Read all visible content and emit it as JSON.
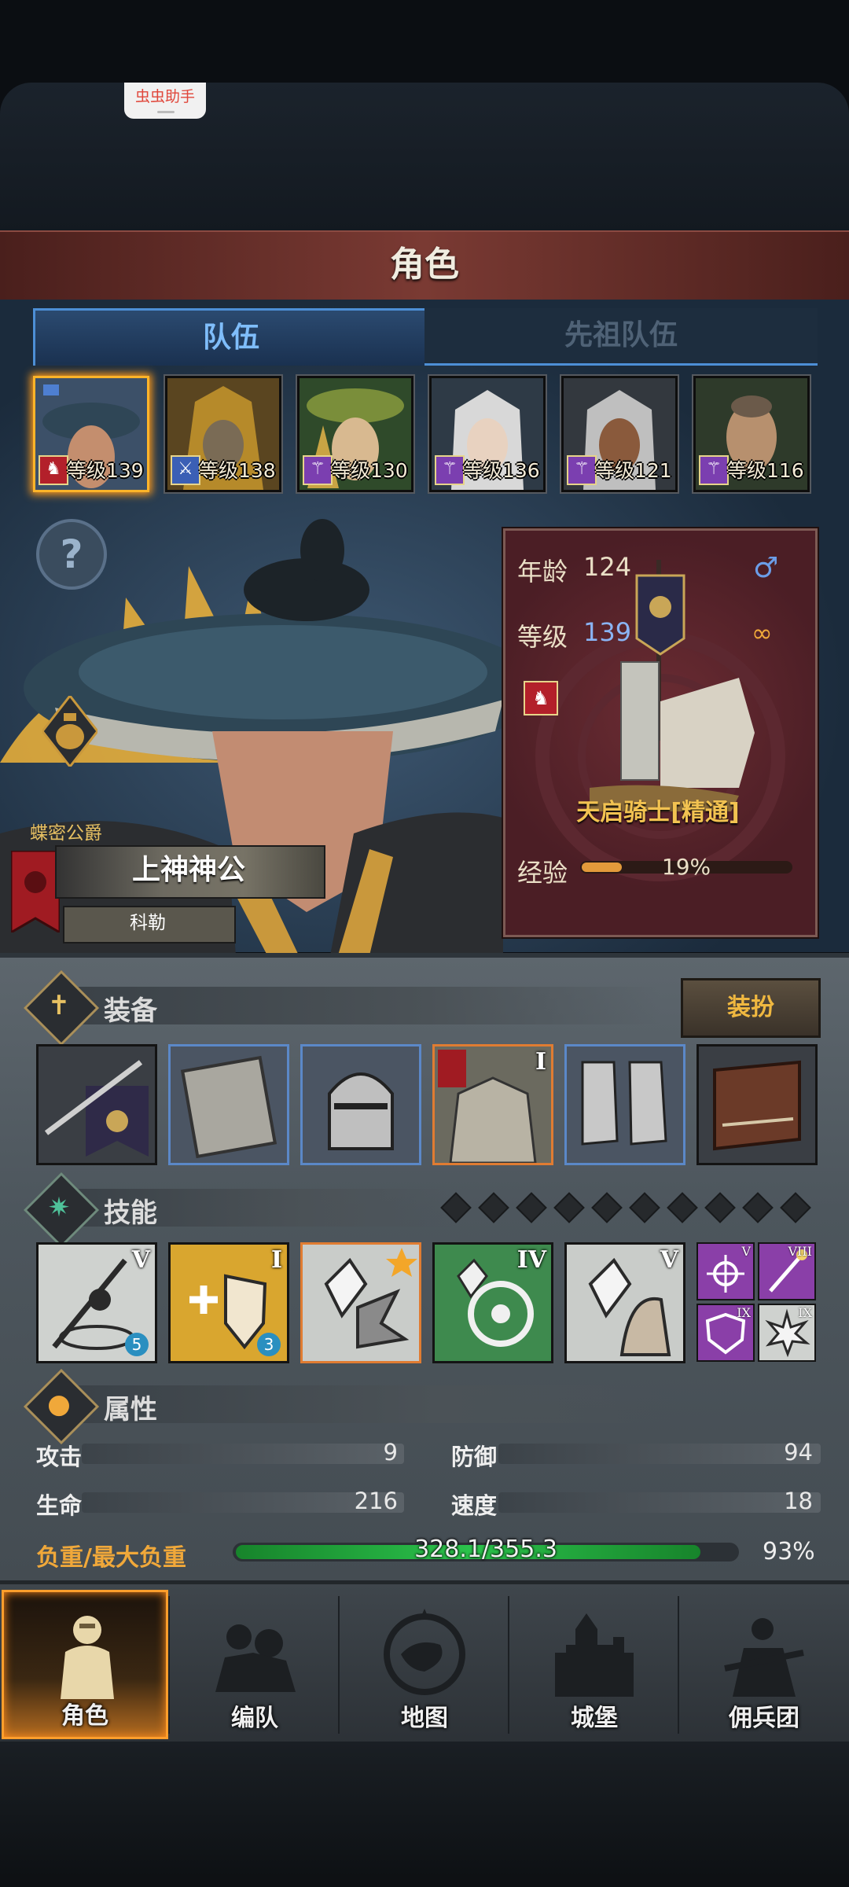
{
  "helper_badge": "虫虫助手",
  "screen_title": "角色",
  "tabs": {
    "team": "队伍",
    "ancestor": "先祖队伍"
  },
  "heroes": [
    {
      "level_text": "等级139",
      "class_icon": "horse-icon",
      "selected": true
    },
    {
      "level_text": "等级138",
      "class_icon": "sword-icon",
      "selected": false
    },
    {
      "level_text": "等级130",
      "class_icon": "staff-icon",
      "selected": false
    },
    {
      "level_text": "等级136",
      "class_icon": "staff-icon",
      "selected": false
    },
    {
      "level_text": "等级121",
      "class_icon": "staff-icon",
      "selected": false
    },
    {
      "level_text": "等级116",
      "class_icon": "staff-icon",
      "selected": false
    }
  ],
  "character": {
    "rank": "蝶密公爵",
    "title": "上神神公",
    "surname": "科勒"
  },
  "stats_panel": {
    "age_label": "年龄",
    "age_value": "124",
    "level_label": "等级",
    "level_value": "139",
    "class_name": "天启骑士[精通]",
    "xp_label": "经验",
    "xp_text": "19%",
    "xp_fraction": 0.19,
    "gender_icon": "male-icon",
    "marriage_icon": "rings-icon"
  },
  "equipment": {
    "title": "装备",
    "outfit_button": "装扮",
    "slots": [
      {
        "name": "banner-spear",
        "rarity": "normal",
        "numeral": ""
      },
      {
        "name": "shield",
        "rarity": "blue",
        "numeral": ""
      },
      {
        "name": "helmet",
        "rarity": "blue",
        "numeral": ""
      },
      {
        "name": "armor",
        "rarity": "orange",
        "numeral": "I"
      },
      {
        "name": "boots",
        "rarity": "blue",
        "numeral": ""
      },
      {
        "name": "book",
        "rarity": "normal",
        "numeral": ""
      }
    ]
  },
  "skills": {
    "title": "技能",
    "empty_slots": 10,
    "items": [
      {
        "numeral": "V",
        "badge": "5"
      },
      {
        "numeral": "I",
        "badge": "3"
      },
      {
        "numeral": "",
        "badge": ""
      },
      {
        "numeral": "IV",
        "badge": ""
      },
      {
        "numeral": "V",
        "badge": ""
      }
    ],
    "mini": [
      {
        "numeral": "V"
      },
      {
        "numeral": "VIII"
      },
      {
        "numeral": "IX"
      },
      {
        "numeral": "IX"
      }
    ]
  },
  "attributes": {
    "title": "属性",
    "attack_label": "攻击",
    "attack_value": "9",
    "defense_label": "防御",
    "defense_value": "94",
    "hp_label": "生命",
    "hp_value": "216",
    "speed_label": "速度",
    "speed_value": "18",
    "load_label": "负重/最大负重",
    "load_text": "328.1/355.3",
    "load_pct": "93%",
    "load_fraction": 0.93
  },
  "nav": [
    {
      "label": "角色",
      "icon": "knight-icon",
      "active": true
    },
    {
      "label": "编队",
      "icon": "formation-icon",
      "active": false
    },
    {
      "label": "地图",
      "icon": "compass-map-icon",
      "active": false
    },
    {
      "label": "城堡",
      "icon": "castle-icon",
      "active": false
    },
    {
      "label": "佣兵团",
      "icon": "mercenary-icon",
      "active": false
    }
  ],
  "colors": {
    "accent": "#ffb429",
    "team_tab": "#4d8fd6",
    "load": "#2bc24b",
    "class_name": "#f2c251"
  }
}
